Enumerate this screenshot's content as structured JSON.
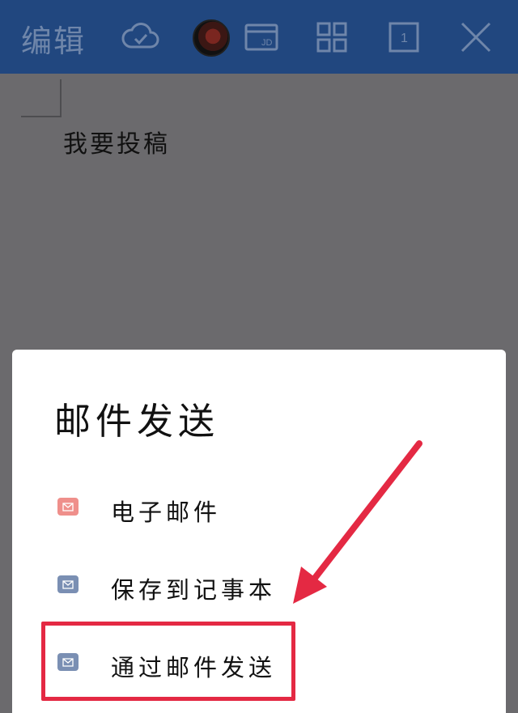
{
  "toolbar": {
    "title": "编辑",
    "icons": [
      "cloud-check-icon",
      "avatar",
      "jd-card-icon",
      "grid-icon",
      "page-count-icon",
      "close-icon"
    ],
    "jd_label": "JD",
    "page_count": "1"
  },
  "document": {
    "text": "我要投稿"
  },
  "dialog": {
    "title": "邮件发送",
    "options": [
      {
        "label": "电子邮件",
        "icon": "mail-icon",
        "color": "#ef8f8b"
      },
      {
        "label": "保存到记事本",
        "icon": "mail-icon",
        "color": "#7a8fb3"
      },
      {
        "label": "通过邮件发送",
        "icon": "mail-icon",
        "color": "#7a8fb3"
      }
    ]
  },
  "annotation": {
    "highlight_color": "#e42943"
  }
}
